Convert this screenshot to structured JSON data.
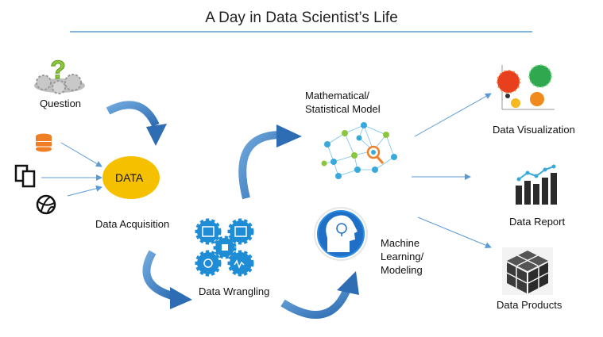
{
  "title": "A Day in Data Scientist’s Life",
  "colors": {
    "rule": "#5b9bd5",
    "arrow": "#3f7fc1",
    "data_oval": "#f5c000",
    "node_blue": "#39a9dc",
    "node_green": "#8cc63f",
    "gear_blue": "#1f8dd6",
    "dark_icon": "#3a3a3a"
  },
  "nodes": {
    "question": "Question",
    "data": "DATA",
    "data_acquisition": "Data Acquisition",
    "data_wrangling": "Data Wrangling",
    "model_line1": "Mathematical/",
    "model_line2": "Statistical Model",
    "ml_line1": "Machine",
    "ml_line2": "Learning/",
    "ml_line3": "Modeling",
    "data_visualization": "Data Visualization",
    "data_report": "Data Report",
    "data_products": "Data Products"
  },
  "icons": [
    "question-gears-icon",
    "database-icon",
    "documents-icon",
    "globe-icon",
    "gears-cluster-icon",
    "network-graph-icon",
    "ai-head-icon",
    "bubble-chart-icon",
    "bar-chart-icon",
    "cubes-icon"
  ]
}
